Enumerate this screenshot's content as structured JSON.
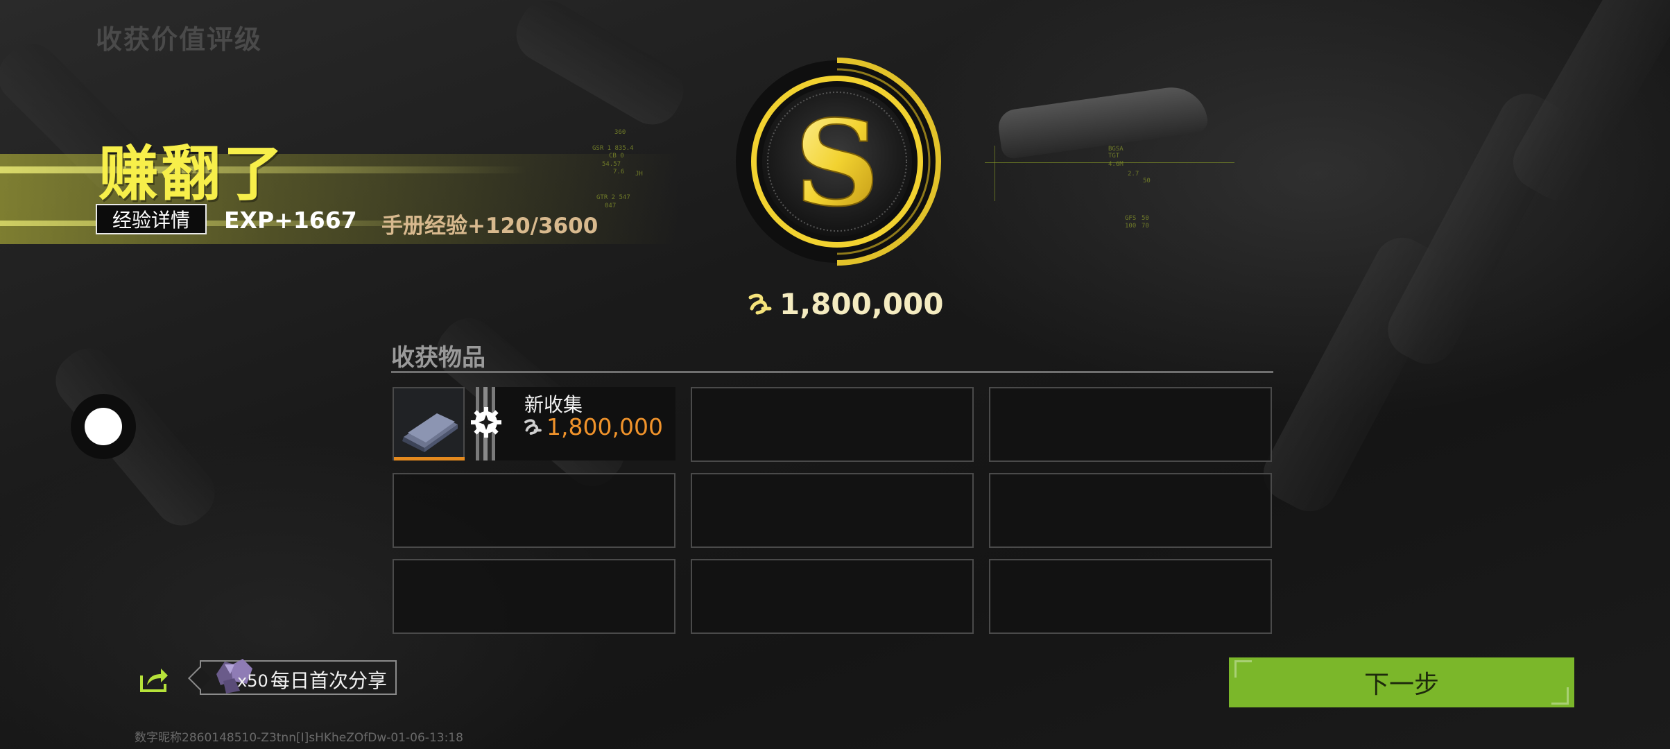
{
  "page_title": "收获价值评级",
  "result": {
    "headline": "赚翻了",
    "exp_detail_button": "经验详情",
    "exp_gain": "EXP+1667",
    "manual_exp": "手册经验+120/3600"
  },
  "rating": {
    "grade": "S",
    "total_value": "1,800,000",
    "currency_icon": "coin-icon"
  },
  "harvest": {
    "section_title": "收获物品",
    "items": [
      {
        "name": "新收集",
        "value": "1,800,000",
        "thumb_icon": "document-item-icon",
        "badge_icon": "gear-badge-icon"
      }
    ],
    "empty_slots": 8
  },
  "share": {
    "reward_qty": "x50",
    "label": "每日首次分享",
    "icon": "share-icon",
    "reward_icon": "gem-icon"
  },
  "next_button": "下一步",
  "watermark": "数字昵称2860148510-Z3tnn[I]sHKheZOfDw-01-06-13:18",
  "hud_text": {
    "left": [
      "360",
      "GSR 1 835.4",
      "CB 0",
      "54.57",
      "7.6",
      "JH",
      "GTR 2 547",
      "047"
    ],
    "right": [
      "BGSA",
      "TGT",
      "4.6M",
      "2.7",
      "50",
      "GFS",
      "100",
      "50",
      "70"
    ]
  },
  "colors": {
    "headline": "#f7ef4a",
    "accent_orange": "#f0932b",
    "next_button": "#7bb72a",
    "manual_exp": "#d8b98e",
    "badge_gold": "#f2d230"
  }
}
